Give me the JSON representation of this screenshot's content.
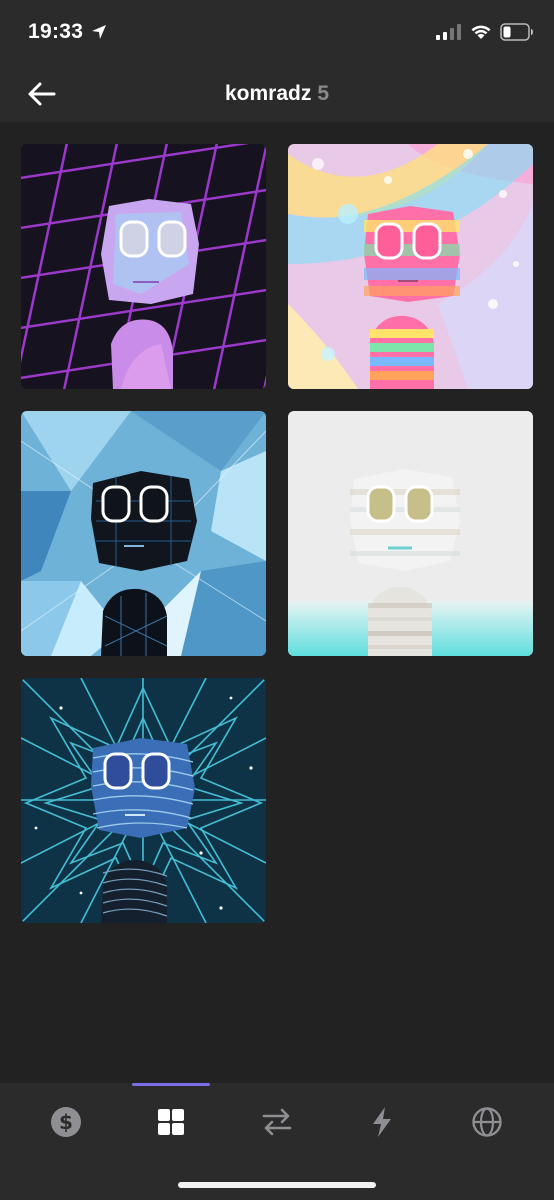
{
  "status_bar": {
    "time": "19:33",
    "icons": [
      "location-arrow-icon",
      "signal-icon",
      "wifi-icon",
      "battery-icon"
    ]
  },
  "header": {
    "title": "komradz",
    "count": "5",
    "back_icon": "back-arrow-icon"
  },
  "collection": {
    "items": [
      {
        "theme": "purple-grid",
        "colors": {
          "bg": "#17121f",
          "grid": "#a23cd4",
          "face": "#c9a7f0"
        }
      },
      {
        "theme": "rainbow-holo",
        "colors": {
          "bg": "#e8c9e8",
          "face": "#ff6fa8",
          "accent": "#7ee0f5"
        }
      },
      {
        "theme": "blue-ice",
        "colors": {
          "bg": "#6fb2d8",
          "face": "#11151d",
          "accent": "#b9e3f7"
        }
      },
      {
        "theme": "white-marble",
        "colors": {
          "bg": "#ececec",
          "face": "#f3f3f3",
          "floor": "#5fdede"
        }
      },
      {
        "theme": "cyan-starburst",
        "colors": {
          "bg": "#0f3346",
          "lines": "#4fd6ee",
          "face": "#3a6fb8"
        }
      }
    ]
  },
  "tab_bar": {
    "tabs": [
      {
        "icon": "dollar-icon",
        "active": false
      },
      {
        "icon": "grid-icon",
        "active": true
      },
      {
        "icon": "swap-arrows-icon",
        "active": false
      },
      {
        "icon": "lightning-icon",
        "active": false
      },
      {
        "icon": "globe-icon",
        "active": false
      }
    ],
    "accent": "#7b6ce8"
  }
}
